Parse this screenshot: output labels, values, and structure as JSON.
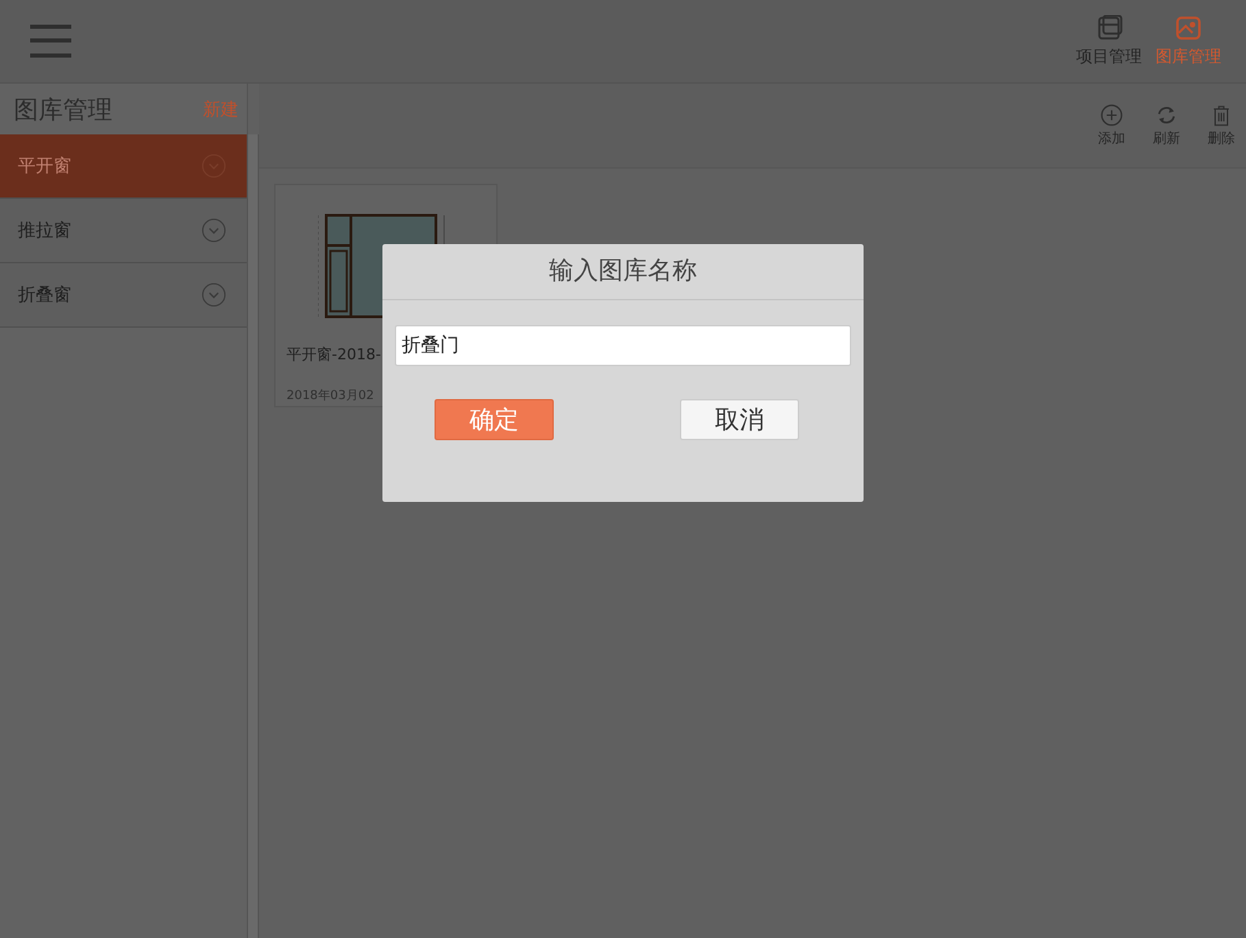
{
  "header": {
    "tabs": [
      {
        "label": "项目管理",
        "selected": false
      },
      {
        "label": "图库管理",
        "selected": true
      }
    ]
  },
  "sidebar": {
    "title": "图库管理",
    "new_button": "新建",
    "items": [
      {
        "label": "平开窗",
        "selected": true
      },
      {
        "label": "推拉窗",
        "selected": false
      },
      {
        "label": "折叠窗",
        "selected": false
      }
    ]
  },
  "toolbar": [
    {
      "label": "添加"
    },
    {
      "label": "刷新"
    },
    {
      "label": "删除"
    }
  ],
  "cards": [
    {
      "title": "平开窗-2018-",
      "date": "2018年03月02"
    }
  ],
  "dialog": {
    "title": "输入图库名称",
    "value": "折叠门",
    "buttons": [
      {
        "label": "确定",
        "kind": "primary"
      },
      {
        "label": "取消",
        "kind": "secondary"
      }
    ]
  }
}
